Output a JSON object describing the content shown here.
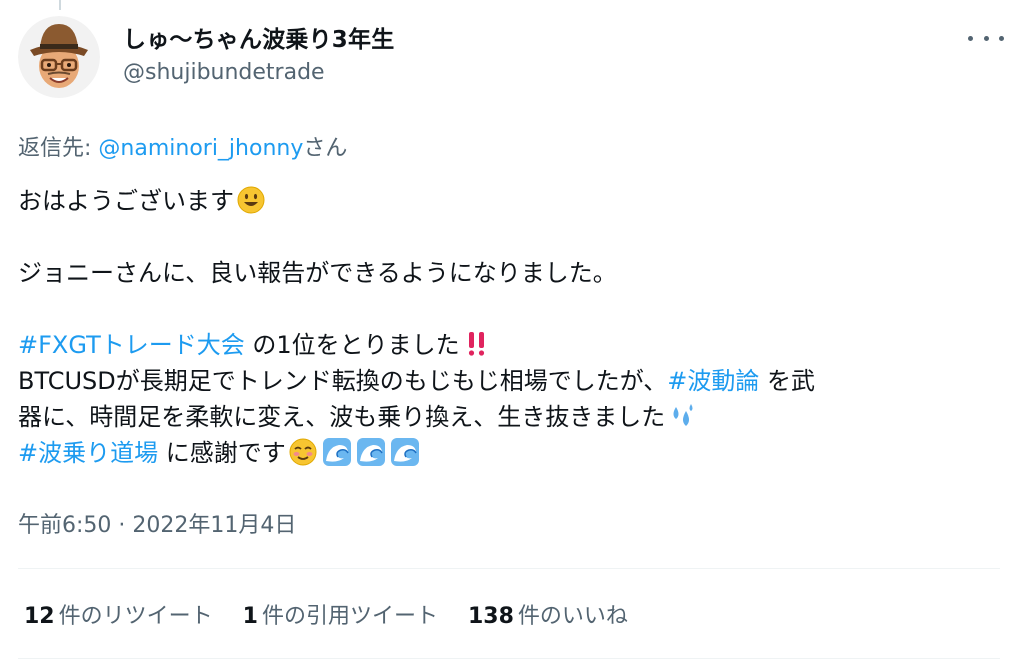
{
  "author": {
    "display_name": "しゅ〜ちゃん波乗り3年生",
    "handle": "@shujibundetrade"
  },
  "reply_to": {
    "prefix": "返信先: ",
    "mention": "@naminori_jhonny",
    "suffix": "さん"
  },
  "tweet": {
    "line1": "おはようございます",
    "line2": "ジョニーさんに、良い報告ができるようになりました。",
    "line3_hashtag": "#FXGTトレード大会",
    "line3_text": " の1位をとりました",
    "line4_text": "BTCUSDが長期足でトレンド転換のもじもじ相場でしたが、",
    "line4_hashtag": "#波動論",
    "line4_text2": " を武",
    "line5_text": "器に、時間足を柔軟に変え、波も乗り換え、生き抜きました",
    "line6_hashtag": "#波乗り道場",
    "line6_text": " に感謝です"
  },
  "timestamp": "午前6:50 · 2022年11月4日",
  "stats": [
    {
      "count": "12",
      "label": "件のリツイート"
    },
    {
      "count": "1",
      "label": "件の引用ツイート"
    },
    {
      "count": "138",
      "label": "件のいいね"
    }
  ],
  "icons": {
    "more": "more-dots-icon",
    "emoji_smile": "grinning-face-icon",
    "emoji_exclaim": "double-exclamation-icon",
    "emoji_sweat": "sweat-droplets-icon",
    "emoji_relieved": "smiling-face-icon",
    "emoji_wave": "water-wave-icon"
  },
  "colors": {
    "link": "#1d9bf0",
    "secondary": "#536471",
    "text": "#0f1419"
  }
}
